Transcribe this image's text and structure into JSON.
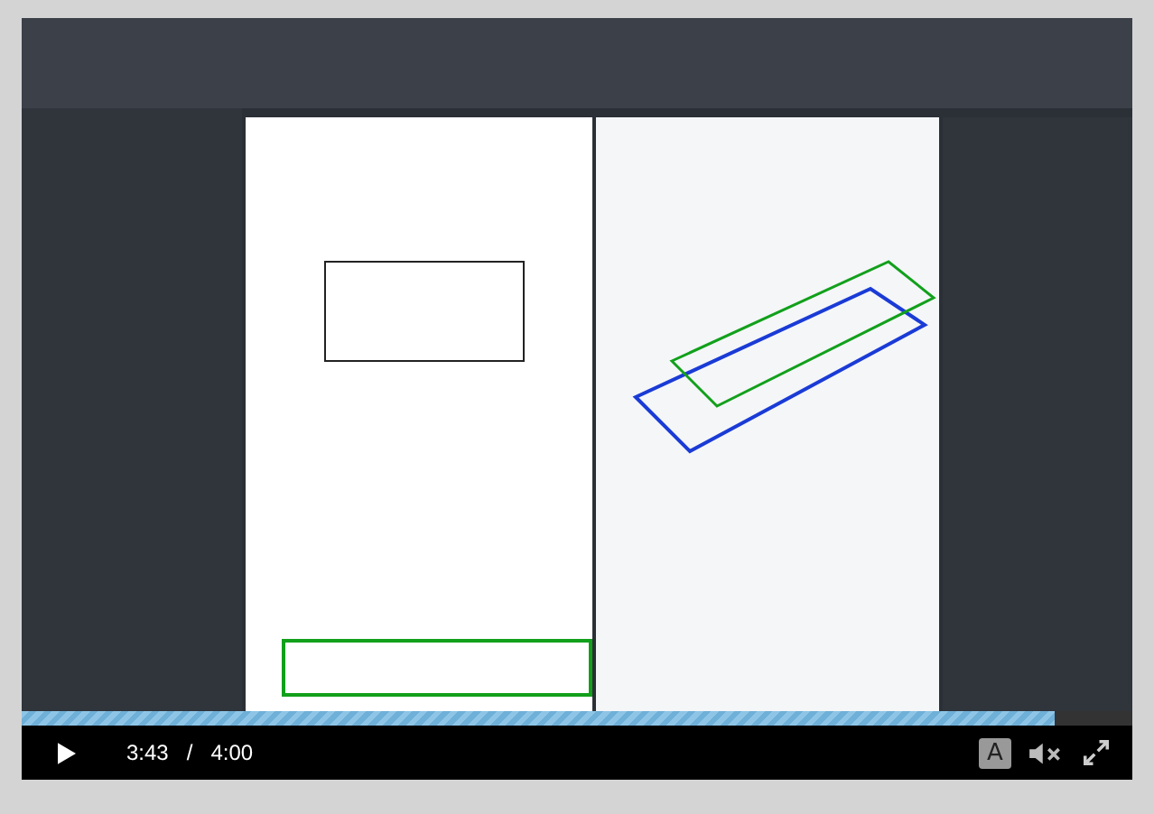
{
  "player": {
    "progress": {
      "level": 0.93
    },
    "current_time": "3:43",
    "separator": "/",
    "duration": "4:00",
    "captions_label": "A",
    "muted": true
  }
}
